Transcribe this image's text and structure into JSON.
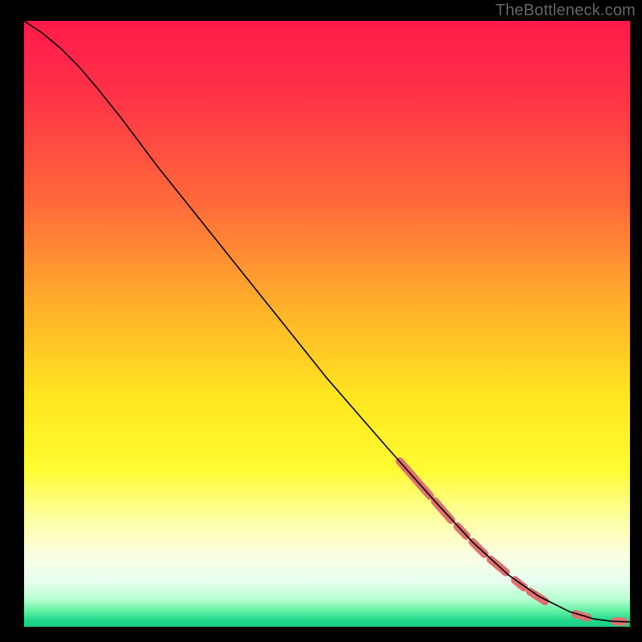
{
  "watermark": "TheBottleneck.com",
  "chart_data": {
    "type": "line",
    "title": "",
    "xlabel": "",
    "ylabel": "",
    "xlim": [
      0,
      100
    ],
    "ylim": [
      0,
      100
    ],
    "grid": false,
    "legend": false,
    "background_gradient": {
      "stops": [
        {
          "offset": 0.0,
          "color": "#ff1a4b"
        },
        {
          "offset": 0.12,
          "color": "#ff3247"
        },
        {
          "offset": 0.3,
          "color": "#ff6a3a"
        },
        {
          "offset": 0.48,
          "color": "#ffb32a"
        },
        {
          "offset": 0.62,
          "color": "#ffe61f"
        },
        {
          "offset": 0.74,
          "color": "#fffb30"
        },
        {
          "offset": 0.82,
          "color": "#fcffa0"
        },
        {
          "offset": 0.88,
          "color": "#fbffe0"
        },
        {
          "offset": 0.925,
          "color": "#e8fff0"
        },
        {
          "offset": 0.955,
          "color": "#b6ffd0"
        },
        {
          "offset": 0.975,
          "color": "#5cf0a0"
        },
        {
          "offset": 0.99,
          "color": "#1fd68a"
        },
        {
          "offset": 1.0,
          "color": "#18cf85"
        }
      ]
    },
    "series": [
      {
        "name": "curve",
        "stroke": "#000000",
        "stroke_width": 1.6,
        "points_xy": [
          [
            0.0,
            100.0
          ],
          [
            3.0,
            98.0
          ],
          [
            6.0,
            95.5
          ],
          [
            9.0,
            92.5
          ],
          [
            12.0,
            89.0
          ],
          [
            16.0,
            84.0
          ],
          [
            22.0,
            76.0
          ],
          [
            30.0,
            66.0
          ],
          [
            40.0,
            53.5
          ],
          [
            50.0,
            41.0
          ],
          [
            60.0,
            29.5
          ],
          [
            68.0,
            20.5
          ],
          [
            74.0,
            14.0
          ],
          [
            80.0,
            8.5
          ],
          [
            85.0,
            5.0
          ],
          [
            90.0,
            2.5
          ],
          [
            94.0,
            1.3
          ],
          [
            97.0,
            0.9
          ],
          [
            100.0,
            0.8
          ]
        ]
      }
    ],
    "highlight_segments": {
      "stroke": "#e07070",
      "stroke_width": 10,
      "segments_xy": [
        [
          [
            62.0,
            27.3
          ],
          [
            67.0,
            21.6
          ]
        ],
        [
          [
            67.8,
            20.7
          ],
          [
            70.5,
            17.6
          ]
        ],
        [
          [
            71.5,
            16.6
          ],
          [
            73.0,
            15.0
          ]
        ],
        [
          [
            74.0,
            14.0
          ],
          [
            76.0,
            12.0
          ]
        ],
        [
          [
            77.0,
            11.1
          ],
          [
            79.5,
            9.0
          ]
        ],
        [
          [
            81.0,
            7.7
          ],
          [
            82.5,
            6.5
          ]
        ],
        [
          [
            83.5,
            5.8
          ],
          [
            86.0,
            4.2
          ]
        ],
        [
          [
            91.0,
            2.1
          ],
          [
            93.0,
            1.5
          ]
        ],
        [
          [
            97.5,
            0.9
          ],
          [
            99.0,
            0.85
          ]
        ]
      ]
    }
  }
}
